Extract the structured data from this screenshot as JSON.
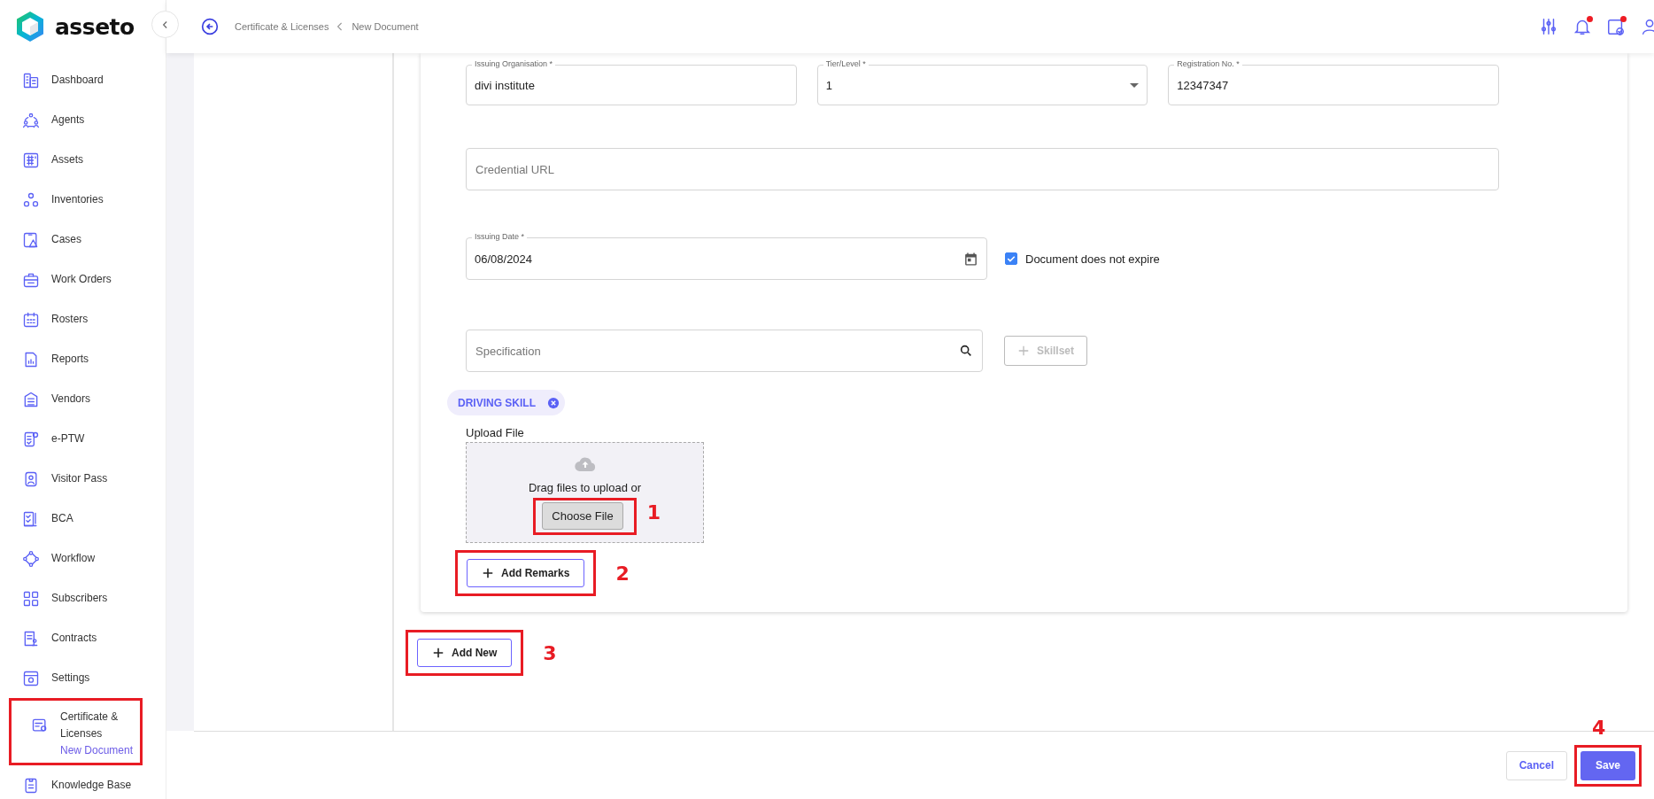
{
  "logo": "asseto",
  "sidebar": {
    "items": [
      {
        "label": "Dashboard",
        "annotated": false
      },
      {
        "label": "Agents",
        "annotated": false
      },
      {
        "label": "Assets",
        "annotated": false
      },
      {
        "label": "Inventories",
        "annotated": false
      },
      {
        "label": "Cases",
        "annotated": false
      },
      {
        "label": "Work Orders",
        "annotated": false
      },
      {
        "label": "Rosters",
        "annotated": false
      },
      {
        "label": "Reports",
        "annotated": false
      },
      {
        "label": "Vendors",
        "annotated": false
      },
      {
        "label": "e-PTW",
        "annotated": false
      },
      {
        "label": "Visitor Pass",
        "annotated": false
      },
      {
        "label": "BCA",
        "annotated": false
      },
      {
        "label": "Workflow",
        "annotated": false
      },
      {
        "label": "Subscribers",
        "annotated": false
      },
      {
        "label": "Contracts",
        "annotated": false
      },
      {
        "label": "Settings",
        "annotated": false
      },
      {
        "label": "Certificate & Licenses",
        "sub": "New Document",
        "annotated": true
      },
      {
        "label": "Knowledge Base",
        "annotated": false
      }
    ]
  },
  "header": {
    "breadcrumb": [
      "Certificate & Licenses",
      "New Document"
    ],
    "icons": [
      {
        "dot": false
      },
      {
        "dot": true
      },
      {
        "dot": true
      },
      {
        "dot": false
      }
    ]
  },
  "form": {
    "row1": [
      {
        "label": "Issuing Organisation *",
        "value": "divi institute",
        "kind": "text"
      },
      {
        "label": "Tier/Level *",
        "value": "1",
        "kind": "select"
      },
      {
        "label": "Registration No. *",
        "value": "12347347",
        "kind": "text"
      }
    ],
    "credential": {
      "placeholder": "Credential URL"
    },
    "issuing_date": {
      "label": "Issuing Date *",
      "value": "06/08/2024"
    },
    "no_expiry": {
      "label": "Document does not expire",
      "checked": true
    },
    "specification": {
      "placeholder": "Specification"
    },
    "skillset_button": {
      "label": "Skillset",
      "disabled": true
    },
    "chips": [
      "DRIVING SKILL"
    ],
    "upload": {
      "label": "Upload File",
      "hint": "Drag files to upload or",
      "button": "Choose File",
      "callout": "1"
    },
    "remarks_button": {
      "label": "Add Remarks",
      "callout": "2"
    }
  },
  "add_new": {
    "label": "Add New",
    "callout": "3"
  },
  "footer": {
    "cancel": "Cancel",
    "save": "Save",
    "callout": "4"
  }
}
